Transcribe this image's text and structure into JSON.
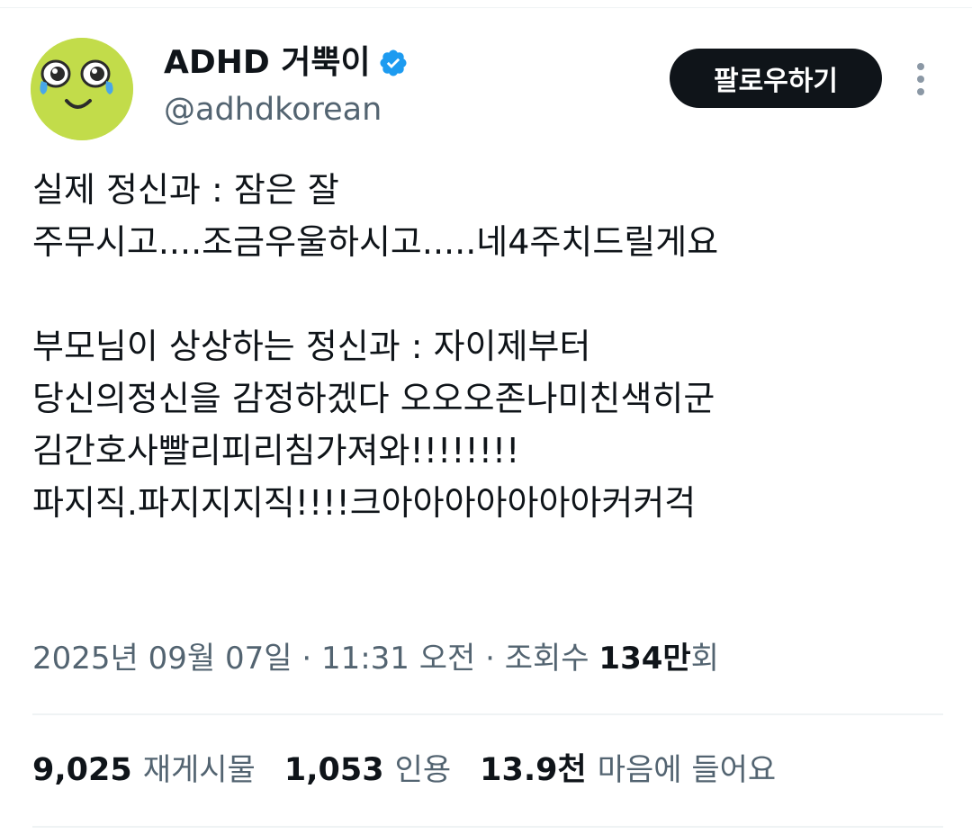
{
  "author": {
    "display_name": "ADHD 거뿍이",
    "handle": "@adhdkorean",
    "avatar_icon": "smiling-face-with-teary-eyes-icon",
    "verified_icon": "verified-badge-icon",
    "verified_color": "#1d9bf0"
  },
  "actions": {
    "follow_label": "팔로우하기",
    "more_icon": "more-vertical-icon"
  },
  "tweet": {
    "lines": [
      "실제 정신과 : 잠은 잘",
      "주무시고....조금우울하시고.....네4주치드릴게요",
      "",
      "부모님이 상상하는 정신과 : 자이제부터",
      "당신의정신을 감정하겠다 오오오존나미친색히군",
      "김간호사빨리피리침가져와!!!!!!!!",
      "파지직.파지지지직!!!!크아아아아아아아커커걱"
    ]
  },
  "meta": {
    "date": "2025년 09월 07일",
    "separator": "·",
    "time": "11:31 오전",
    "views_label_prefix": "조회수",
    "views_value": "134만",
    "views_suffix": "회"
  },
  "stats": {
    "reposts_value": "9,025",
    "reposts_label": "재게시물",
    "quotes_value": "1,053",
    "quotes_label": "인용",
    "likes_value": "13.9천",
    "likes_label": "마음에 들어요"
  },
  "colors": {
    "text_primary": "#0f1419",
    "text_secondary": "#536471",
    "button_bg": "#0f1419",
    "avatar_bg": "#c2dc4a",
    "divider": "#eff3f4"
  }
}
